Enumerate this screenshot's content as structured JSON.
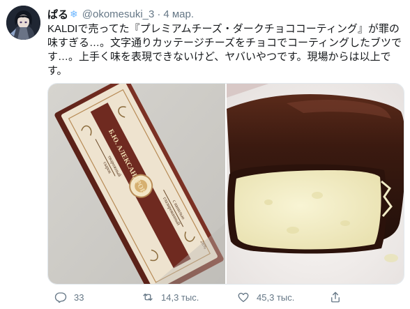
{
  "tweet": {
    "display_name": "ぱる",
    "name_emoji": "❄",
    "handle": "@okomesuki_3",
    "separator": "·",
    "date": "4 мар.",
    "text": "KALDIで売ってた『プレミアムチーズ・ダークチョココーティング』が罪の味すぎる…。文字通りカッテージチーズをチョコでコーティングしたブツです…。上手く味を表現できないけど、ヤバいやつです。現場からは以上です。",
    "actions": {
      "reply_count": "33",
      "retweet_count": "14,3 тыс.",
      "like_count": "45,3 тыс."
    }
  },
  "package_text": {
    "line1": "сырок",
    "line2": "творожный",
    "brand": "Б.Ю. АЛЕКСАНДРОВ",
    "line3": "глазированный",
    "line4": "с ванилью",
    "fat": "26%"
  },
  "colors": {
    "text_primary": "#14171a",
    "text_secondary": "#657786",
    "border": "#e1e8ed",
    "chocolate": "#3b1a10",
    "cheese": "#f4efc6",
    "package_cream": "#eee3cf",
    "package_brown": "#6f2a20"
  },
  "icons": [
    "avatar",
    "snowflake-icon",
    "reply-icon",
    "retweet-icon",
    "like-icon",
    "share-icon"
  ]
}
